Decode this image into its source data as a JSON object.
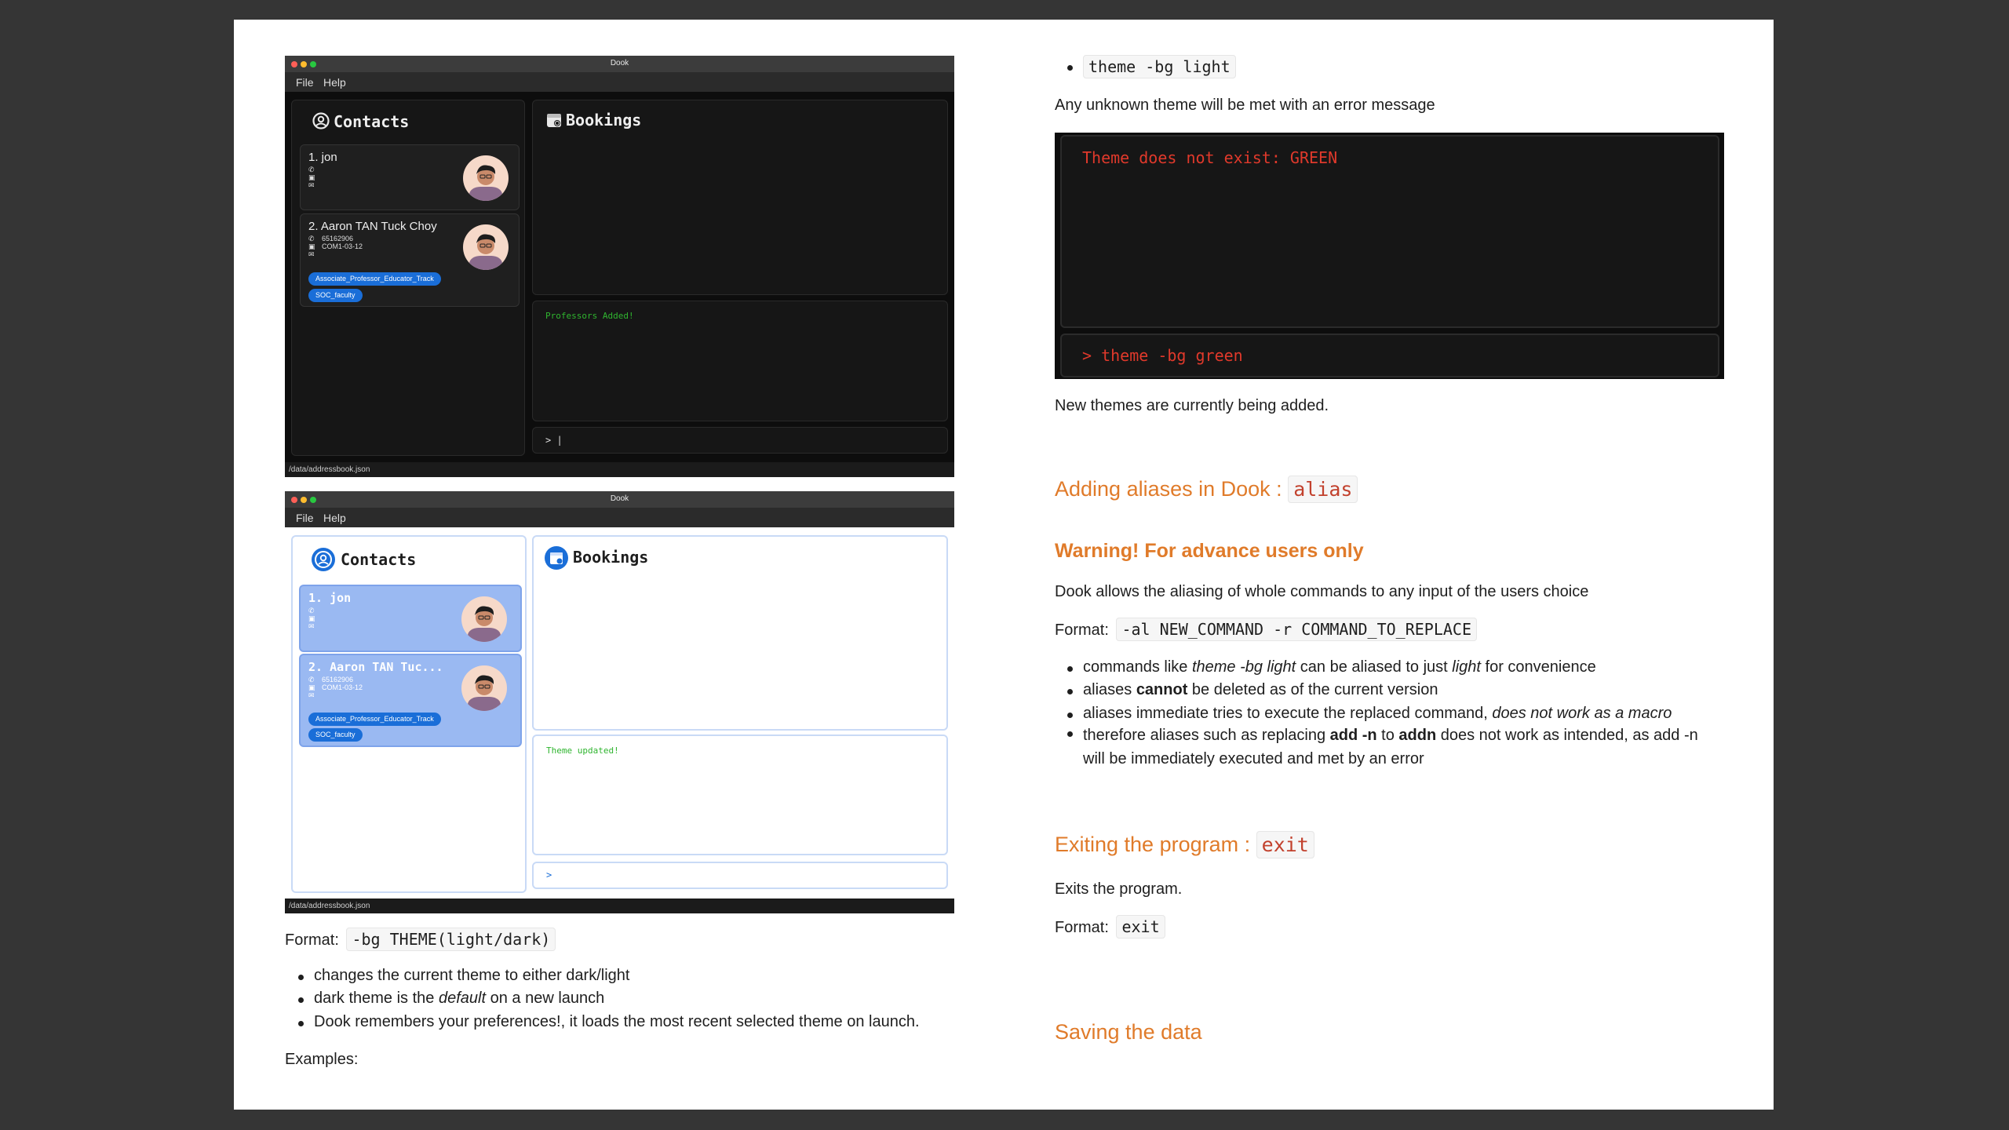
{
  "window_dark": {
    "title": "Dook",
    "menu": [
      "File",
      "Help"
    ],
    "contacts_title": "Contacts",
    "bookings_title": "Bookings",
    "contacts": [
      {
        "name": "1. jon"
      },
      {
        "name": "2. Aaron TAN Tuck Choy",
        "phone": "65162906",
        "office": "COM1-03-12",
        "tags": [
          "Associate_Professor_Educator_Track",
          "SOC_faculty"
        ]
      }
    ],
    "result": "Professors Added!",
    "command_prompt": "> |",
    "status": "/data/addressbook.json"
  },
  "window_light": {
    "title": "Dook",
    "menu": [
      "File",
      "Help"
    ],
    "contacts_title": "Contacts",
    "bookings_title": "Bookings",
    "contacts": [
      {
        "name": "1. jon"
      },
      {
        "name": "2. Aaron TAN Tuc...",
        "phone": "65162906",
        "office": "COM1-03-12",
        "tags": [
          "Associate_Professor_Educator_Track",
          "SOC_faculty"
        ]
      }
    ],
    "result": "Theme updated!",
    "command_prompt": ">",
    "status": "/data/addressbook.json"
  },
  "left_doc": {
    "format_label": "Format:",
    "format_code": "-bg THEME(light/dark)",
    "bullets": [
      "changes the current theme to either dark/light",
      "dark theme is the default on a new launch",
      "Dook remembers your preferences!, it loads the most recent selected theme on launch."
    ],
    "bullet2_pre": "dark theme is the ",
    "bullet2_em": "default",
    "bullet2_post": " on a new launch",
    "examples": "Examples:"
  },
  "right_doc": {
    "example_code": "theme -bg light",
    "unknown_theme": "Any unknown theme will be met with an error message",
    "error_box": {
      "result": "Theme does not exist: GREEN",
      "command": "> theme -bg green"
    },
    "new_themes": "New themes are currently being added.",
    "alias_heading": "Adding aliases in Dook :",
    "alias_code": "alias",
    "warning_heading": "Warning! For advance users only",
    "alias_desc": "Dook allows the aliasing of whole commands to any input of the users choice",
    "format_label": "Format:",
    "alias_format_code": "-al NEW_COMMAND -r COMMAND_TO_REPLACE",
    "alias_bullets": {
      "b1_pre": "commands like ",
      "b1_em1": "theme -bg light",
      "b1_mid": " can be aliased to just ",
      "b1_em2": "light",
      "b1_post": " for convenience",
      "b2_pre": "aliases ",
      "b2_strong": "cannot",
      "b2_post": " be deleted as of the current version",
      "b3_pre": "aliases immediate tries to execute the replaced command, ",
      "b3_em": "does not work as a macro",
      "b4_pre": "therefore aliases such as replacing ",
      "b4_s1": "add -n",
      "b4_mid": " to ",
      "b4_s2": "addn",
      "b4_post": " does not work as intended, as add -n",
      "b4_line2": "will be immediately executed and met by an error"
    },
    "exit_heading": "Exiting the program :",
    "exit_code": "exit",
    "exit_desc": "Exits the program.",
    "exit_format_label": "Format:",
    "exit_format_code": "exit",
    "saving_heading": "Saving the data"
  },
  "colors": {
    "accent_orange": "#e07b2a",
    "error_red": "#e0392b",
    "result_green": "#2fb52f",
    "tag_blue": "#1a6ed8",
    "light_card": "#9ab9f2"
  }
}
